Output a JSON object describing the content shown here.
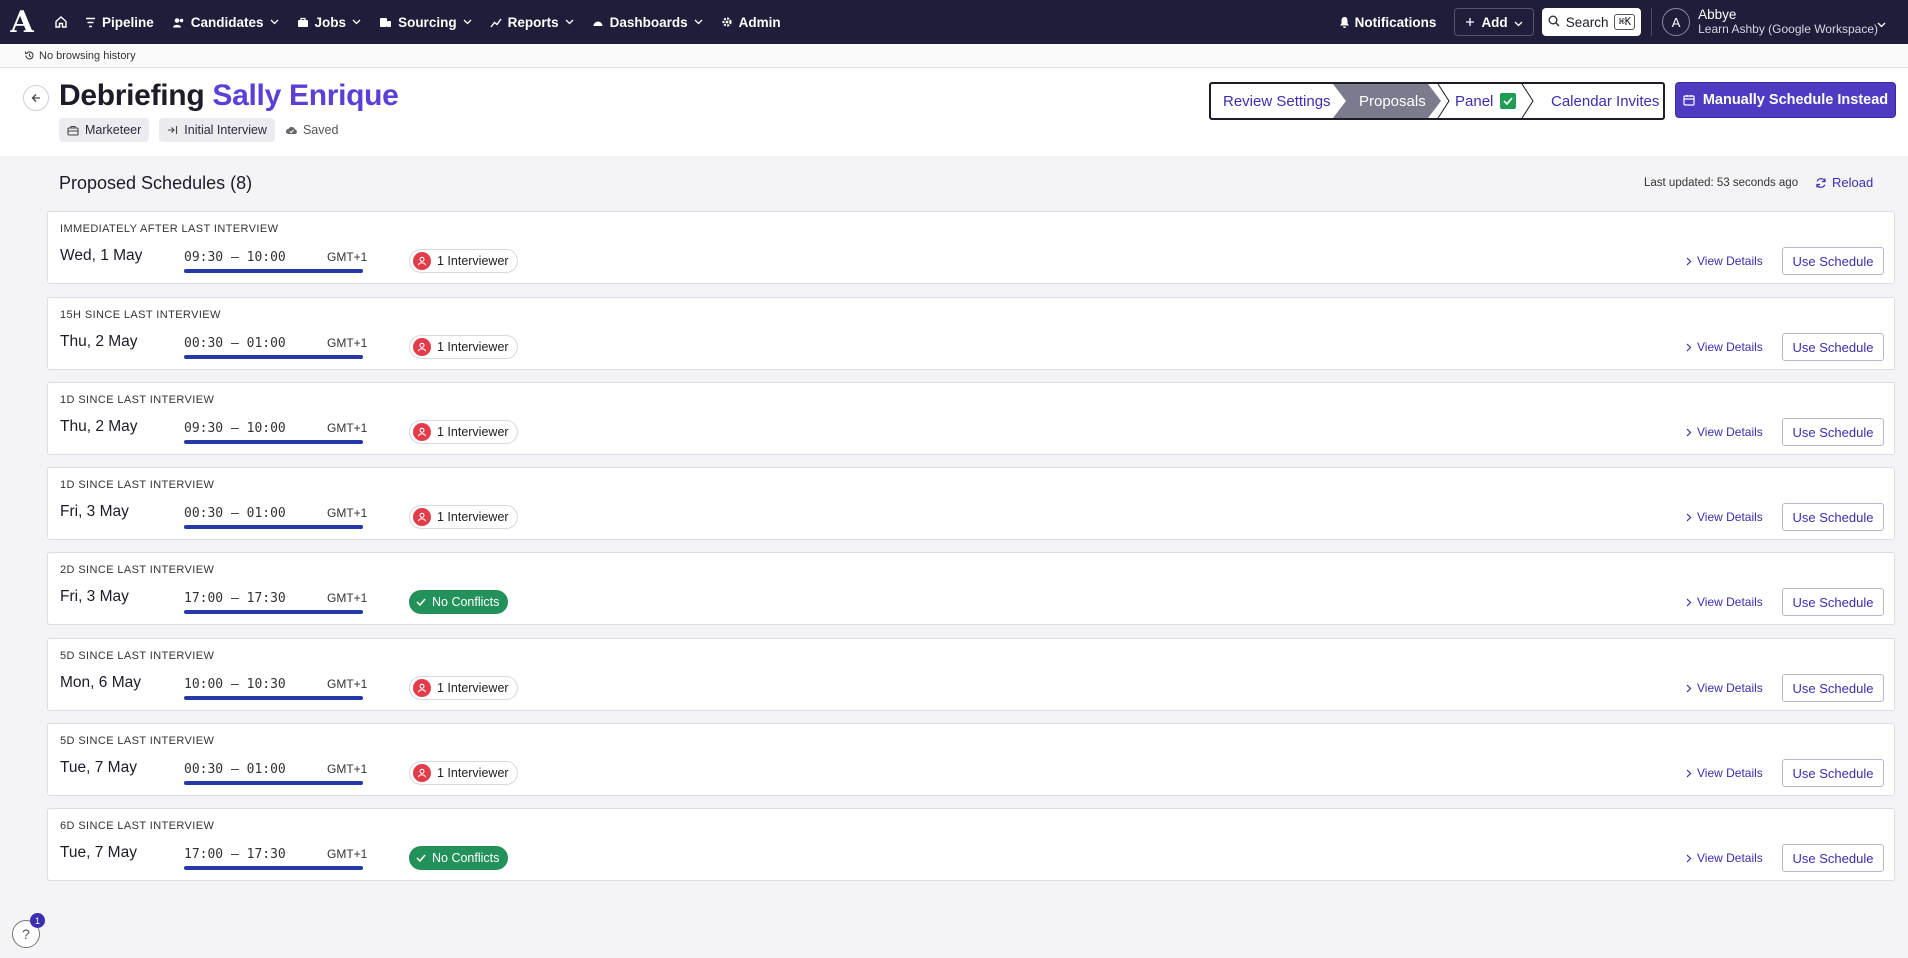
{
  "nav": {
    "logo": "A",
    "items": [
      {
        "label": "Pipeline",
        "icon": "filter-icon",
        "dropdown": false
      },
      {
        "label": "Candidates",
        "icon": "people-icon",
        "dropdown": true
      },
      {
        "label": "Jobs",
        "icon": "briefcase-icon",
        "dropdown": true
      },
      {
        "label": "Sourcing",
        "icon": "sourcing-icon",
        "dropdown": true
      },
      {
        "label": "Reports",
        "icon": "chart-icon",
        "dropdown": true
      },
      {
        "label": "Dashboards",
        "icon": "gauge-icon",
        "dropdown": true
      },
      {
        "label": "Admin",
        "icon": "gear-icon",
        "dropdown": false
      }
    ],
    "notifications": "Notifications",
    "add": "Add",
    "search": "Search",
    "search_shortcut": "⌘K",
    "user_initial": "A",
    "user_name": "Abbye",
    "user_org": "Learn Ashby (Google Workspace)"
  },
  "history": "No browsing history",
  "header": {
    "title_prefix": "Debriefing",
    "candidate": "Sally Enrique",
    "tags": [
      "Marketeer",
      "Initial Interview"
    ],
    "saved": "Saved",
    "steps": [
      "Review Settings",
      "Proposals",
      "Panel",
      "Calendar Invites"
    ],
    "manual_button": "Manually Schedule Instead"
  },
  "content": {
    "section_title": "Proposed Schedules (8)",
    "last_updated": "Last updated: 53 seconds ago",
    "reload": "Reload",
    "view_details": "View Details",
    "use_schedule": "Use Schedule",
    "schedules": [
      {
        "label": "Immediately after last interview",
        "date": "Wed, 1 May",
        "time": "09:30 – 10:00",
        "tz": "GMT+1",
        "status": "1 Interviewer",
        "conflict": true
      },
      {
        "label": "15h since last interview",
        "date": "Thu, 2 May",
        "time": "00:30 – 01:00",
        "tz": "GMT+1",
        "status": "1 Interviewer",
        "conflict": true
      },
      {
        "label": "1d since last interview",
        "date": "Thu, 2 May",
        "time": "09:30 – 10:00",
        "tz": "GMT+1",
        "status": "1 Interviewer",
        "conflict": true
      },
      {
        "label": "1d since last interview",
        "date": "Fri, 3 May",
        "time": "00:30 – 01:00",
        "tz": "GMT+1",
        "status": "1 Interviewer",
        "conflict": true
      },
      {
        "label": "2d since last interview",
        "date": "Fri, 3 May",
        "time": "17:00 – 17:30",
        "tz": "GMT+1",
        "status": "No Conflicts",
        "conflict": false
      },
      {
        "label": "5d since last interview",
        "date": "Mon, 6 May",
        "time": "10:00 – 10:30",
        "tz": "GMT+1",
        "status": "1 Interviewer",
        "conflict": true
      },
      {
        "label": "5d since last interview",
        "date": "Tue, 7 May",
        "time": "00:30 – 01:00",
        "tz": "GMT+1",
        "status": "1 Interviewer",
        "conflict": true
      },
      {
        "label": "6d since last interview",
        "date": "Tue, 7 May",
        "time": "17:00 – 17:30",
        "tz": "GMT+1",
        "status": "No Conflicts",
        "conflict": false
      }
    ]
  },
  "help": {
    "label": "?",
    "badge": "1"
  },
  "colors": {
    "nav_bg": "#1e1d3a",
    "accent": "#4d3bc2",
    "conflict": "#e23b4a",
    "ok": "#23915a",
    "bar": "#2438a8"
  }
}
